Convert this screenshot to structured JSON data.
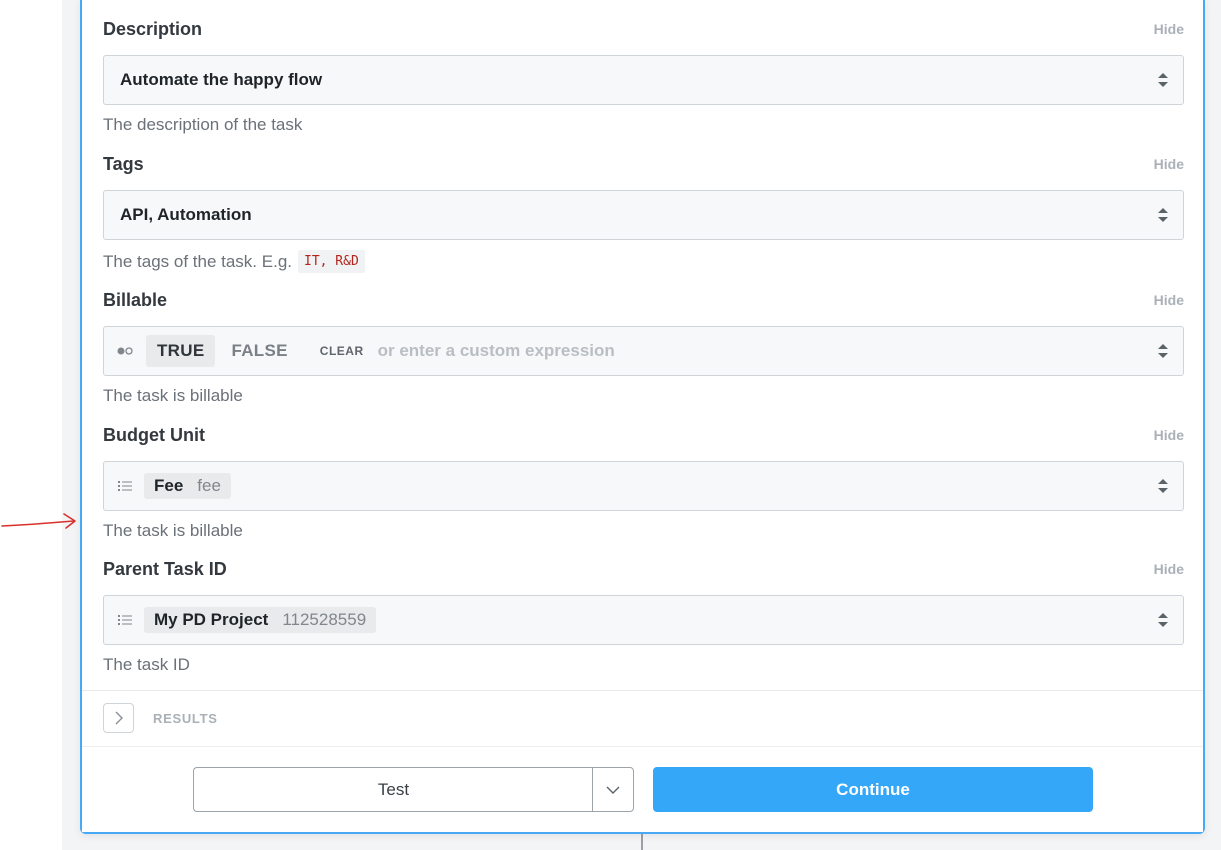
{
  "fields": [
    {
      "label": "Description",
      "hide": "Hide",
      "value": "Automate the happy flow",
      "help": "The description of the task"
    },
    {
      "label": "Tags",
      "hide": "Hide",
      "value": "API, Automation",
      "help": "The tags of the task. E.g.",
      "help_code": "IT, R&D"
    },
    {
      "label": "Billable",
      "hide": "Hide",
      "true_label": "TRUE",
      "false_label": "FALSE",
      "clear_label": "CLEAR",
      "custom_placeholder": "or enter a custom expression",
      "help": "The task is billable"
    },
    {
      "label": "Budget Unit",
      "hide": "Hide",
      "option_label": "Fee",
      "option_value": "fee",
      "help": "The task is billable"
    },
    {
      "label": "Parent Task ID",
      "hide": "Hide",
      "option_label": "My PD Project",
      "option_value": "112528559",
      "help": "The task ID"
    }
  ],
  "results": {
    "label": "RESULTS"
  },
  "footer": {
    "test_label": "Test",
    "continue_label": "Continue"
  },
  "colors": {
    "accent": "#35a7f8",
    "panel_border": "#47a9f5",
    "annotation_arrow": "#d9302c"
  }
}
